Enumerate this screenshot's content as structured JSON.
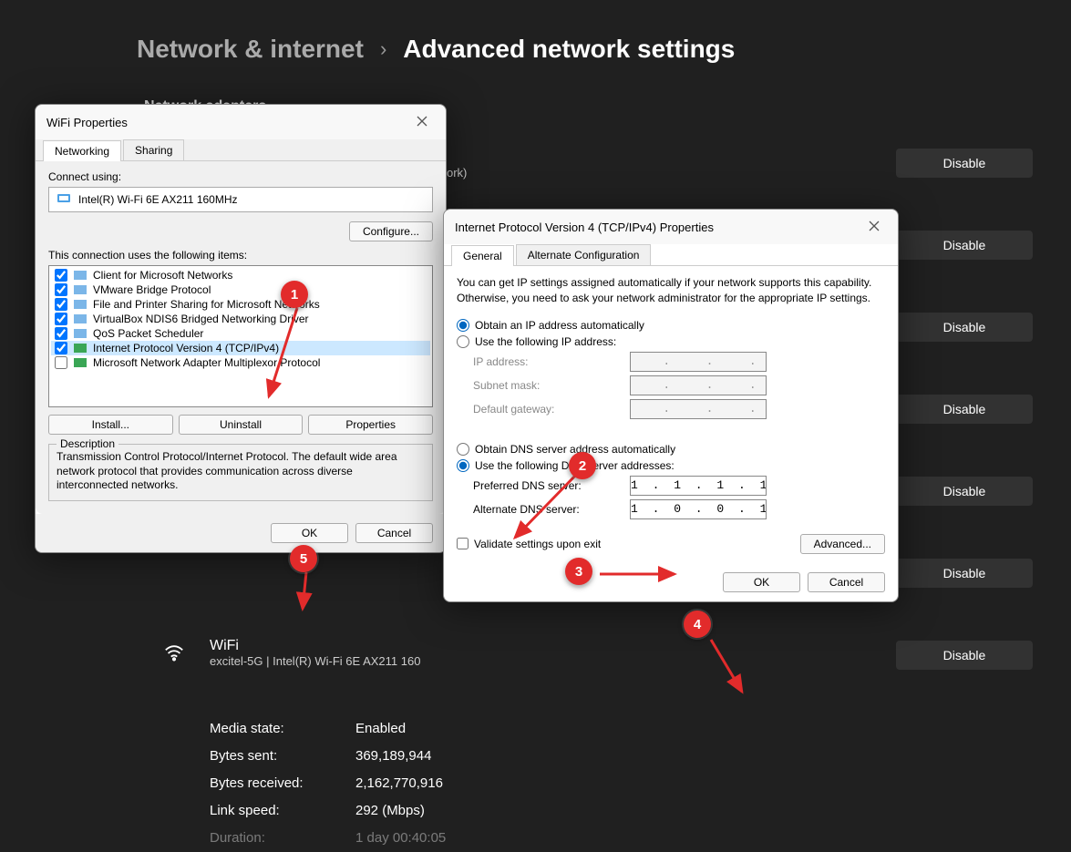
{
  "breadcrumb": {
    "parent": "Network & internet",
    "sep": "›",
    "current": "Advanced network settings"
  },
  "section_label": "Network adapters",
  "disable_label": "Disable",
  "network_subtitle_fragment": "ork)",
  "wifi_adapter": {
    "name": "WiFi",
    "detail_prefix": "excitel-5G | Intel(R) Wi-Fi 6E AX211 160"
  },
  "stats": [
    {
      "label": "Media state:",
      "value": "Enabled"
    },
    {
      "label": "Bytes sent:",
      "value": "369,189,944"
    },
    {
      "label": "Bytes received:",
      "value": "2,162,770,916"
    },
    {
      "label": "Link speed:",
      "value": "292 (Mbps)"
    },
    {
      "label": "Duration:",
      "value": "1 day 00:40:05"
    }
  ],
  "dlg1": {
    "title": "WiFi Properties",
    "tabs": [
      "Networking",
      "Sharing"
    ],
    "connect_using_label": "Connect using:",
    "adapter": "Intel(R) Wi-Fi 6E AX211 160MHz",
    "configure_btn": "Configure...",
    "items_label": "This connection uses the following items:",
    "items": [
      {
        "checked": true,
        "label": "Client for Microsoft Networks"
      },
      {
        "checked": true,
        "label": "VMware Bridge Protocol"
      },
      {
        "checked": true,
        "label": "File and Printer Sharing for Microsoft Networks"
      },
      {
        "checked": true,
        "label": "VirtualBox NDIS6 Bridged Networking Driver"
      },
      {
        "checked": true,
        "label": "QoS Packet Scheduler"
      },
      {
        "checked": true,
        "label": "Internet Protocol Version 4 (TCP/IPv4)",
        "selected": true
      },
      {
        "checked": false,
        "label": "Microsoft Network Adapter Multiplexor Protocol"
      }
    ],
    "install_btn": "Install...",
    "uninstall_btn": "Uninstall",
    "properties_btn": "Properties",
    "desc_legend": "Description",
    "description": "Transmission Control Protocol/Internet Protocol. The default wide area network protocol that provides communication across diverse interconnected networks.",
    "ok_btn": "OK",
    "cancel_btn": "Cancel"
  },
  "dlg2": {
    "title": "Internet Protocol Version 4 (TCP/IPv4) Properties",
    "tabs": [
      "General",
      "Alternate Configuration"
    ],
    "intro": "You can get IP settings assigned automatically if your network supports this capability. Otherwise, you need to ask your network administrator for the appropriate IP settings.",
    "ip_auto": "Obtain an IP address automatically",
    "ip_manual": "Use the following IP address:",
    "ip_address_lbl": "IP address:",
    "subnet_lbl": "Subnet mask:",
    "gateway_lbl": "Default gateway:",
    "dns_auto": "Obtain DNS server address automatically",
    "dns_manual": "Use the following DNS server addresses:",
    "pref_dns_lbl": "Preferred DNS server:",
    "pref_dns_value": "1 . 1 . 1 . 1",
    "alt_dns_lbl": "Alternate DNS server:",
    "alt_dns_value": "1 . 0 . 0 . 1",
    "validate_lbl": "Validate settings upon exit",
    "advanced_btn": "Advanced...",
    "ok_btn": "OK",
    "cancel_btn": "Cancel"
  },
  "callouts": {
    "c1": "1",
    "c2": "2",
    "c3": "3",
    "c4": "4",
    "c5": "5"
  }
}
